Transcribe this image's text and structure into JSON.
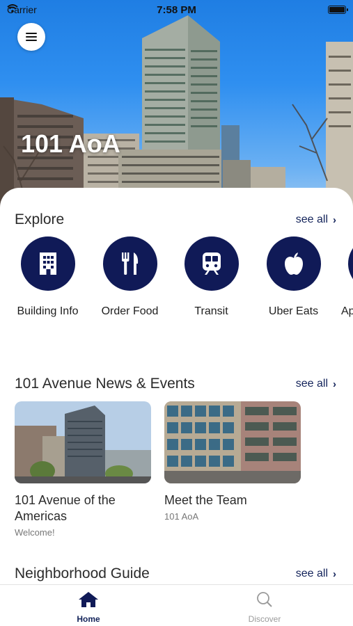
{
  "status_bar": {
    "carrier": "Carrier",
    "time": "7:58 PM"
  },
  "hero": {
    "title": "101 AoA"
  },
  "explore": {
    "title": "Explore",
    "see_all": "see all",
    "items": [
      {
        "label": "Building Info",
        "icon": "building-icon"
      },
      {
        "label": "Order Food",
        "icon": "fork-knife-icon"
      },
      {
        "label": "Transit",
        "icon": "train-icon"
      },
      {
        "label": "Uber Eats",
        "icon": "apple-icon"
      },
      {
        "label": "Ap",
        "icon": "partial-icon"
      }
    ]
  },
  "news": {
    "title": "101 Avenue News & Events",
    "see_all": "see all",
    "cards": [
      {
        "title": "101 Avenue of the Americas",
        "subtitle": "Welcome!"
      },
      {
        "title": "Meet the Team",
        "subtitle": "101 AoA"
      }
    ]
  },
  "neighborhood": {
    "title": "Neighborhood Guide",
    "see_all": "see all"
  },
  "tabbar": {
    "tabs": [
      {
        "label": "Home",
        "icon": "home-icon",
        "active": true
      },
      {
        "label": "Discover",
        "icon": "search-icon",
        "active": false
      }
    ]
  },
  "colors": {
    "primary": "#101a57",
    "accent_text": "#13235a",
    "sky": "#2f8ff0"
  }
}
